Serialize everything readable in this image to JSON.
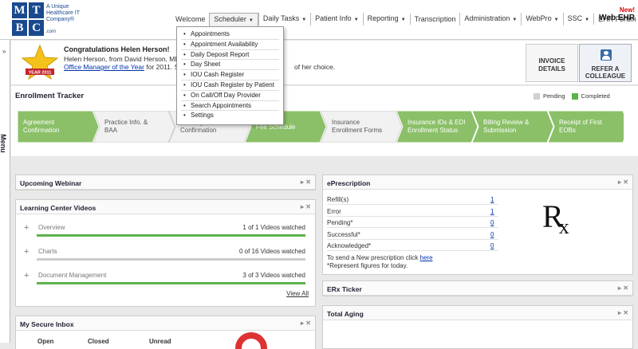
{
  "logo": {
    "letters": [
      "M",
      "T",
      "B",
      "C"
    ],
    "tagline": "A Unique Healthcare IT Company",
    "suffix": ".com",
    "trademark": "®"
  },
  "nav": {
    "items": [
      {
        "label": "Welcome",
        "caret": false
      },
      {
        "label": "Scheduler",
        "caret": true
      },
      {
        "label": "Daily Tasks",
        "caret": true
      },
      {
        "label": "Patient Info",
        "caret": true
      },
      {
        "label": "Reporting",
        "caret": true
      },
      {
        "label": "Transcription",
        "caret": false
      },
      {
        "label": "Administration",
        "caret": true
      },
      {
        "label": "WebPro",
        "caret": true
      },
      {
        "label": "SSC",
        "caret": true
      },
      {
        "label": "EHR Forum",
        "caret": false
      }
    ],
    "caret_glyph": "▼",
    "webehr_new": "New!",
    "webehr_brand": "Web EHR"
  },
  "scheduler_menu": [
    "Appointments",
    "Appointment Availability",
    "Daily Deposit Report",
    "Day Sheet",
    "IOU Cash Register",
    "IOU Cash Register by Patient",
    "On Call/Off Day Provider",
    "Search Appointments",
    "Settings"
  ],
  "side_menu": {
    "arrows": "»",
    "label": "Menu"
  },
  "banner": {
    "title": "Congratulations Helen Herson!",
    "line1": "Helen Herson, from David Herson, MD, P",
    "link": "Office Manager of the Year",
    "line2_rest": " for 2011. She",
    "tail": "of her choice.",
    "badge_text": "YEAR 2011",
    "invoice_label": "INVOICE DETAILS",
    "refer_label": "REFER A COLLEAGUE"
  },
  "tracker": {
    "title": "Enrollment Tracker",
    "legend_pending": "Pending",
    "legend_completed": "Completed",
    "steps": [
      {
        "label": "Agreement Confirmation",
        "done": true
      },
      {
        "label": "Practice Info. & BAA",
        "done": false
      },
      {
        "label": "Training Confirmation",
        "done": false
      },
      {
        "label": "Fee Schedule",
        "done": true
      },
      {
        "label": "Insurance Enrollment Forms",
        "done": false
      },
      {
        "label": "Insurance IDs & EDI Enrollment Status",
        "done": true
      },
      {
        "label": "Billing Review & Submission",
        "done": true
      },
      {
        "label": "Receipt of First EOBs",
        "done": true
      }
    ],
    "color_pending": "#d0d0d0",
    "color_completed": "#5cb34a"
  },
  "widgets": {
    "controls": "▸ ✕",
    "webinar": {
      "title": "Upcoming Webinar"
    },
    "learning": {
      "title": "Learning Center Videos",
      "rows": [
        {
          "name": "Overview",
          "count": "1 of 1 Videos watched",
          "progress": 1.0
        },
        {
          "name": "Charts",
          "count": "0 of 16 Videos watched",
          "progress": 0.0
        },
        {
          "name": "Document Management",
          "count": "3 of 3 Videos watched",
          "progress": 1.0
        }
      ],
      "view_all": "View All"
    },
    "inbox": {
      "title": "My Secure Inbox",
      "cols": [
        "Open",
        "Closed",
        "Unread"
      ]
    },
    "eprescription": {
      "title": "ePrescription",
      "rows": [
        {
          "label": "Refill(s)",
          "value": "1"
        },
        {
          "label": "Error",
          "value": "1"
        },
        {
          "label": "Pending*",
          "value": "0"
        },
        {
          "label": "Successful*",
          "value": "0"
        },
        {
          "label": "Acknowledged*",
          "value": "0"
        }
      ],
      "note_prefix": "To send a New prescription click ",
      "note_link": "here",
      "note2": "*Represent figures for today.",
      "rx_r": "R",
      "rx_x": "x"
    },
    "erx": {
      "title": "ERx Ticker"
    },
    "aging": {
      "title": "Total Aging"
    }
  }
}
